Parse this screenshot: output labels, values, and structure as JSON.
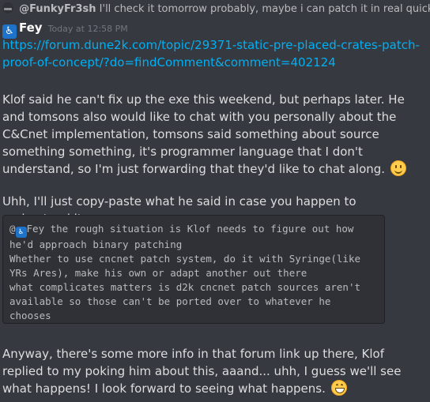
{
  "reply": {
    "mention": "@FunkyFr3sh",
    "preview": "I'll check it tomorrow probably, maybe i can patch it in real quick"
  },
  "author": {
    "badge_icon": "wheelchair-icon",
    "name": "Fey",
    "timestamp": "Today at 12:58 PM"
  },
  "message": {
    "link": "https://forum.dune2k.com/topic/29371-static-pre-placed-crates-patch-proof-of-concept/?do=findComment&comment=402124",
    "para1": "Klof said he can't fix up the exe this weekend, but perhaps later. He and tomsons also would like to chat with you personally about the C&Cnet implementation, tomsons said something about source something something, it's programmer language that I don't understand, so I'm just forwarding that they'd like to chat along.",
    "para2": "Uhh, I'll just copy-paste what he said in case you happen to understand it:",
    "code_mention_prefix": "@",
    "code_lines": [
      "Fey the rough situation is Klof needs to figure out how",
      "he'd approach binary patching",
      "Whether to use cncnet patch system, do it with Syringe(like",
      "YRs Ares), make his own or adapt another out there",
      "what complicates matters is d2k cncnet patch sources aren't",
      "available so those can't be ported over to whatever he",
      "chooses"
    ],
    "para3": "Anyway, there's some more info in that forum link up there, Klof replied to my poking him about this, aaand... uhh, I guess we'll see what happens! I look forward to seeing what happens."
  },
  "emojis": {
    "smile": "slightly-smiling-face-icon",
    "grin": "grinning-face-icon"
  },
  "colors": {
    "background": "#36393f",
    "link": "#00b0f4",
    "username": "#ffffff",
    "timestamp": "#72767d",
    "code_bg": "#2f3136"
  }
}
